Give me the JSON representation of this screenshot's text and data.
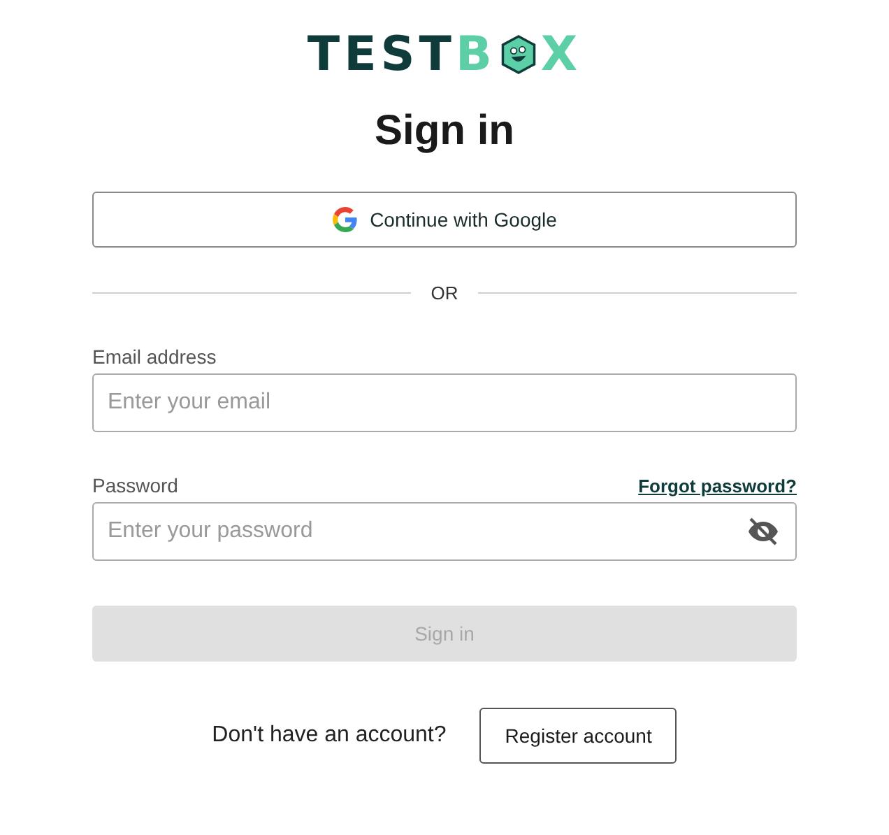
{
  "logo": {
    "text_dark": "TEST",
    "text_green_before": "B",
    "text_green_after": "X"
  },
  "heading": "Sign in",
  "google_button": {
    "label": "Continue with Google"
  },
  "divider": "OR",
  "email": {
    "label": "Email address",
    "placeholder": "Enter your email"
  },
  "password": {
    "label": "Password",
    "forgot_link": "Forgot password?",
    "placeholder": "Enter your password",
    "visible": false
  },
  "submit": {
    "label": "Sign in",
    "disabled": true
  },
  "register": {
    "prompt": "Don't have an account?",
    "button": "Register account"
  }
}
